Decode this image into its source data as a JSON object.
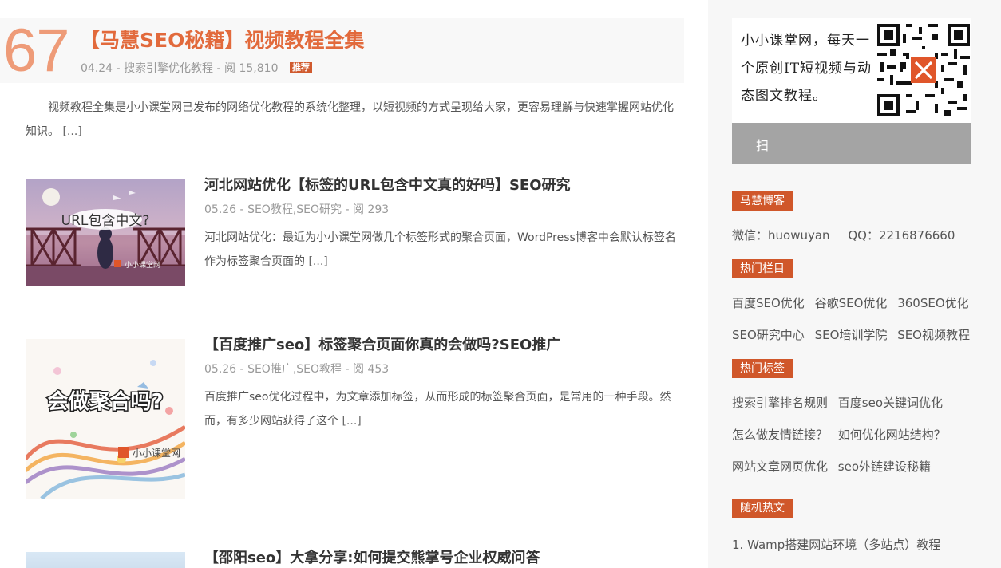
{
  "featured": {
    "number": "67",
    "title": "【马慧SEO秘籍】视频教程全集",
    "date": "04.24",
    "category": "搜索引擎优化教程",
    "views_label": "阅",
    "views": "15,810",
    "badge": "推荐",
    "excerpt": "视频教程全集是小小课堂网已发布的网络优化教程的系统化整理，以短视频的方式呈现给大家，更容易理解与快速掌握网站优化知识。",
    "more": "[...]"
  },
  "posts": [
    {
      "title": "河北网站优化【标签的URL包含中文真的好吗】SEO研究",
      "date": "05.26",
      "category": "SEO教程,SEO研究",
      "views_label": "阅",
      "views": "293",
      "excerpt": "河北网站优化：最近为小小课堂网做几个标签形式的聚合页面，WordPress博客中会默认标签名作为标签聚合页面的",
      "more": "[...]",
      "thumb_text": "URL包含中文?",
      "thumb_watermark": "小小课堂网"
    },
    {
      "title": "【百度推广seo】标签聚合页面你真的会做吗?SEO推广",
      "date": "05.26",
      "category": "SEO推广,SEO教程",
      "views_label": "阅",
      "views": "453",
      "excerpt": "百度推广seo优化过程中，为文章添加标签，从而形成的标签聚合页面，是常用的一种手段。然而，有多少网站获得了这个",
      "more": "[...]",
      "thumb_text": "会做聚合吗?",
      "thumb_watermark": "小小课堂网"
    },
    {
      "title": "【邵阳seo】大拿分享:如何提交熊掌号企业权威问答"
    }
  ],
  "sidebar": {
    "qr_text": "小小课堂网，每天一个原创IT短视频与动态图文教程。",
    "scan_label": "扫",
    "blog_heading": "马慧博客",
    "wechat": "微信：huowuyan",
    "qq": "QQ：2216876660",
    "hot_columns_heading": "热门栏目",
    "hot_columns": [
      "百度SEO优化",
      "谷歌SEO优化",
      "360SEO优化",
      "SEO研究中心",
      "SEO培训学院",
      "SEO视频教程"
    ],
    "hot_tags_heading": "热门标签",
    "hot_tags": [
      "搜索引擎排名规则",
      "百度seo关键词优化",
      "怎么做友情链接？",
      "如何优化网站结构？",
      "网站文章网页优化",
      "seo外链建设秘籍"
    ],
    "random_heading": "随机热文",
    "random_posts": [
      "1. Wamp搭建网站环境（多站点）教程"
    ]
  },
  "colors": {
    "accent": "#d0572a",
    "number": "#ee9b78",
    "title": "#e26a3c",
    "gray_bar": "#a4a4a4"
  }
}
